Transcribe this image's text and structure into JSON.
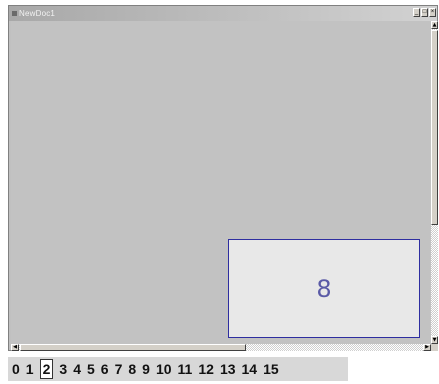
{
  "window": {
    "title": "NewDoc1",
    "controls": {
      "minimize": "_",
      "maximize": "□",
      "close": "×"
    }
  },
  "scrollbars": {
    "up_arrow": "▲",
    "down_arrow": "▼",
    "left_arrow": "◀",
    "right_arrow": "▶"
  },
  "card": {
    "label": "8"
  },
  "tabs": [
    {
      "label": "0"
    },
    {
      "label": "1"
    },
    {
      "label": "2",
      "active": true
    },
    {
      "label": "3"
    },
    {
      "label": "4"
    },
    {
      "label": "5"
    },
    {
      "label": "6"
    },
    {
      "label": "7"
    },
    {
      "label": "8"
    },
    {
      "label": "9"
    },
    {
      "label": "10"
    },
    {
      "label": "11"
    },
    {
      "label": "12"
    },
    {
      "label": "13"
    },
    {
      "label": "14"
    },
    {
      "label": "15"
    }
  ]
}
